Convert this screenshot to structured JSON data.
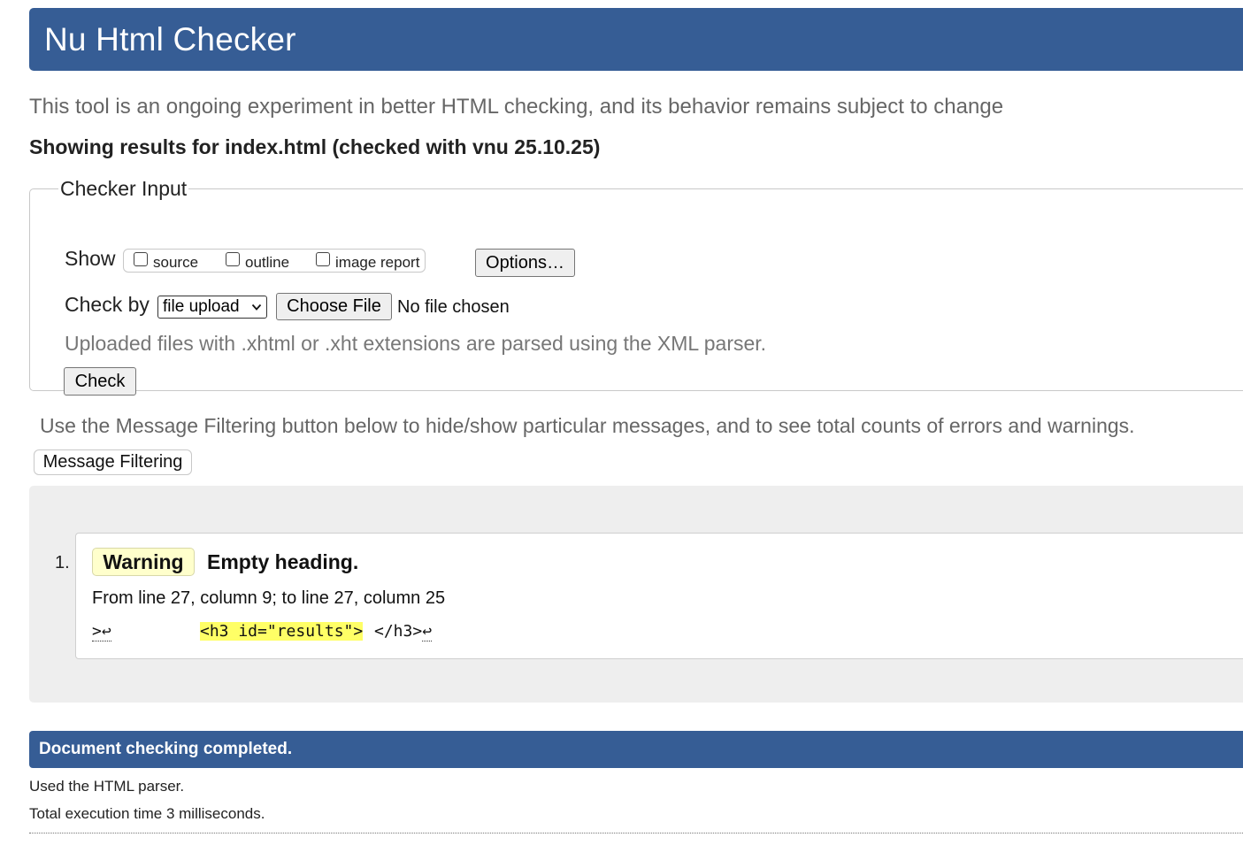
{
  "header": {
    "title": "Nu Html Checker"
  },
  "intro": "This tool is an ongoing experiment in better HTML checking, and its behavior remains subject to change",
  "results_title": "Showing results for index.html (checked with vnu 25.10.25)",
  "checker_input": {
    "legend": "Checker Input",
    "show_label": "Show",
    "show_options": [
      {
        "label": "source",
        "checked": false
      },
      {
        "label": "outline",
        "checked": false
      },
      {
        "label": "image report",
        "checked": false
      }
    ],
    "options_button": "Options…",
    "check_by_label": "Check by",
    "check_by_value": "file upload",
    "choose_file_button": "Choose File",
    "file_status": "No file chosen",
    "upload_note": "Uploaded files with .xhtml or .xht extensions are parsed using the XML parser.",
    "check_button": "Check"
  },
  "filtering": {
    "note": "Use the Message Filtering button below to hide/show particular messages, and to see total counts of errors and warnings.",
    "button": "Message Filtering"
  },
  "messages": [
    {
      "number": "1.",
      "type": "Warning",
      "title": "Empty heading.",
      "location": "From line 27, column 9; to line 27, column 25",
      "extract_before": ">",
      "return_symbol": "↩",
      "extract_highlight": "<h3 id=\"results\">",
      "extract_after": "</h3>",
      "highlight_color": "#ffff66"
    }
  ],
  "completion": {
    "banner": "Document checking completed.",
    "parser_note": "Used the HTML parser.",
    "exec_time": "Total execution time 3 milliseconds."
  },
  "colors": {
    "header_bg": "#365d95",
    "warning_badge_bg": "#ffffcc",
    "message_area_bg": "#eeeeee"
  }
}
